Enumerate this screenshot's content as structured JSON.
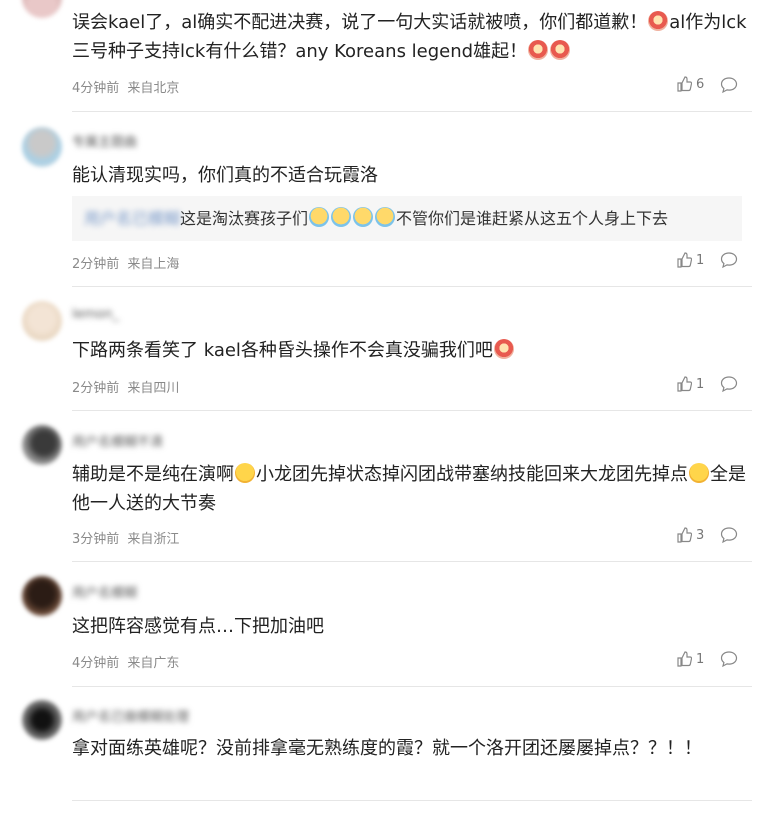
{
  "comments": [
    {
      "username": "",
      "text_parts": [
        "误会kael了，al确实不配进决赛，说了一句大实话就被喷，你们都道歉！",
        "al作为lck三号种子支持lck有什么错？any Koreans legend雄起！"
      ],
      "time": "4分钟前",
      "location": "来自北京",
      "likes": "6"
    },
    {
      "username": "专属主题曲",
      "text": "能认清现实吗，你们真的不适合玩霞洛",
      "reply_user": "用户名已模糊",
      "reply_text_a": "这是淘汰赛孩子们",
      "reply_text_b": "不管你们是谁赶紧从这五个人身上下去",
      "time": "2分钟前",
      "location": "来自上海",
      "likes": "1"
    },
    {
      "username": "lemon_",
      "text": "下路两条看笑了 kael各种昏头操作不会真没骗我们吧",
      "time": "2分钟前",
      "location": "来自四川",
      "likes": "1"
    },
    {
      "username": "用户名模糊不清",
      "text_a": "辅助是不是纯在演啊",
      "text_b": "小龙团先掉状态掉闪团战带塞纳技能回来大龙团先掉点",
      "text_c": "全是他一人送的大节奏",
      "time": "3分钟前",
      "location": "来自浙江",
      "likes": "3"
    },
    {
      "username": "用户名模糊",
      "text": "这把阵容感觉有点…下把加油吧",
      "time": "4分钟前",
      "location": "来自广东",
      "likes": "1"
    },
    {
      "username": "用户名已做模糊处理",
      "text": "拿对面练英雄呢？没前排拿毫无熟练度的霞？就一个洛开团还屡屡掉点？？！！",
      "time": "",
      "location": "",
      "likes": ""
    }
  ]
}
